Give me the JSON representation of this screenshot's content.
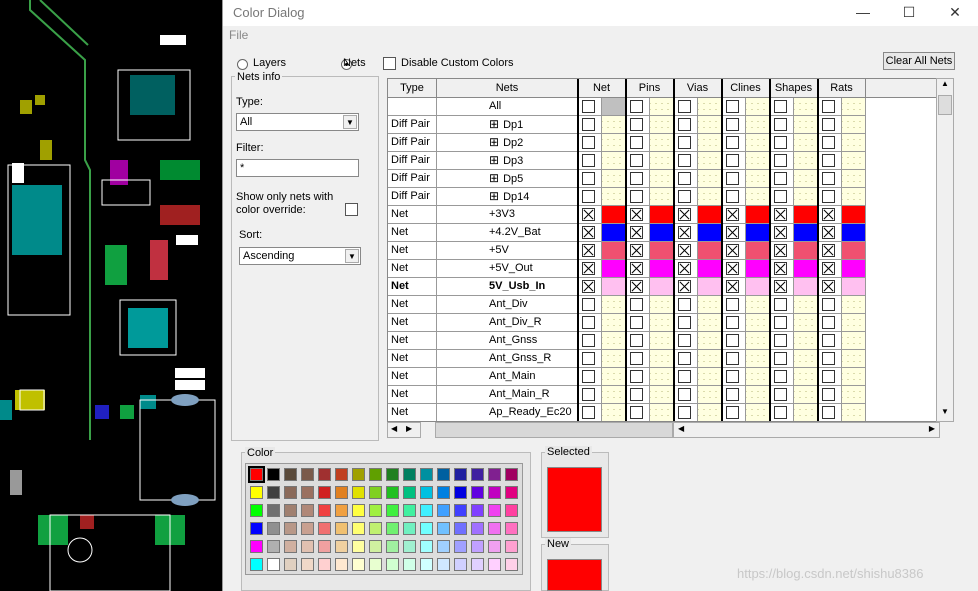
{
  "window": {
    "title": "Color Dialog",
    "minimize": "—",
    "maximize": "☐",
    "close": "✕"
  },
  "menu": {
    "file": "File"
  },
  "mode": {
    "layers": "Layers",
    "nets": "Nets",
    "selected": "nets"
  },
  "disable_custom": {
    "label": "Disable Custom Colors",
    "checked": false
  },
  "clear_all": "Clear All Nets",
  "nets_info": {
    "title": "Nets info",
    "type_label": "Type:",
    "type_value": "All",
    "filter_label": "Filter:",
    "filter_value": "*",
    "show_only_label": "Show only nets with color override:",
    "sort_label": "Sort:",
    "sort_value": "Ascending"
  },
  "grid": {
    "headers": [
      "Type",
      "Nets",
      "Net",
      "Pins",
      "Vias",
      "Clines",
      "Shapes",
      "Rats"
    ],
    "rows": [
      {
        "type": "",
        "name": "All",
        "expand": false,
        "bold": false,
        "checked": false,
        "color": "#c0c0c0"
      },
      {
        "type": "Diff Pair",
        "name": "Dp1",
        "expand": true,
        "bold": false,
        "checked": false,
        "color": ""
      },
      {
        "type": "Diff Pair",
        "name": "Dp2",
        "expand": true,
        "bold": false,
        "checked": false,
        "color": ""
      },
      {
        "type": "Diff Pair",
        "name": "Dp3",
        "expand": true,
        "bold": false,
        "checked": false,
        "color": ""
      },
      {
        "type": "Diff Pair",
        "name": "Dp5",
        "expand": true,
        "bold": false,
        "checked": false,
        "color": ""
      },
      {
        "type": "Diff Pair",
        "name": "Dp14",
        "expand": true,
        "bold": false,
        "checked": false,
        "color": ""
      },
      {
        "type": "Net",
        "name": "+3V3",
        "expand": false,
        "bold": false,
        "checked": true,
        "color": "#ff0000"
      },
      {
        "type": "Net",
        "name": "+4.2V_Bat",
        "expand": false,
        "bold": false,
        "checked": true,
        "color": "#0000ff"
      },
      {
        "type": "Net",
        "name": "+5V",
        "expand": false,
        "bold": false,
        "checked": true,
        "color": "#f05070"
      },
      {
        "type": "Net",
        "name": "+5V_Out",
        "expand": false,
        "bold": false,
        "checked": true,
        "color": "#ff00ff"
      },
      {
        "type": "Net",
        "name": "5V_Usb_In",
        "expand": false,
        "bold": true,
        "checked": true,
        "color": "#ffc0f0"
      },
      {
        "type": "Net",
        "name": "Ant_Div",
        "expand": false,
        "bold": false,
        "checked": false,
        "color": ""
      },
      {
        "type": "Net",
        "name": "Ant_Div_R",
        "expand": false,
        "bold": false,
        "checked": false,
        "color": ""
      },
      {
        "type": "Net",
        "name": "Ant_Gnss",
        "expand": false,
        "bold": false,
        "checked": false,
        "color": ""
      },
      {
        "type": "Net",
        "name": "Ant_Gnss_R",
        "expand": false,
        "bold": false,
        "checked": false,
        "color": ""
      },
      {
        "type": "Net",
        "name": "Ant_Main",
        "expand": false,
        "bold": false,
        "checked": false,
        "color": ""
      },
      {
        "type": "Net",
        "name": "Ant_Main_R",
        "expand": false,
        "bold": false,
        "checked": false,
        "color": ""
      },
      {
        "type": "Net",
        "name": "Ap_Ready_Ec20",
        "expand": false,
        "bold": false,
        "checked": false,
        "color": ""
      }
    ]
  },
  "color_panel": {
    "title": "Color",
    "selected_label": "Selected",
    "new_label": "New",
    "selected_color": "#ff0000",
    "new_color": "#ff0000"
  },
  "palette": [
    [
      "#ff0000",
      "#000000",
      "#5a4a3a",
      "#7a5a4a",
      "#a03030",
      "#c04020",
      "#a0a000",
      "#60a000",
      "#208020",
      "#008060",
      "#0090a0",
      "#0060a0",
      "#2020a0",
      "#4020a0",
      "#802090",
      "#a00060"
    ],
    [
      "#ffff00",
      "#404040",
      "#8a6a5a",
      "#9a7060",
      "#d02020",
      "#e08020",
      "#e0e000",
      "#80d020",
      "#20c020",
      "#00c080",
      "#00c0e0",
      "#0080e0",
      "#0000e0",
      "#6000e0",
      "#c000c0",
      "#e00080"
    ],
    [
      "#00ff00",
      "#707070",
      "#a08070",
      "#b08878",
      "#f04040",
      "#f0a040",
      "#ffff40",
      "#a0f040",
      "#40f040",
      "#40f0a0",
      "#40f0ff",
      "#40a0ff",
      "#4040ff",
      "#8040ff",
      "#f040f0",
      "#ff40a0"
    ],
    [
      "#0000ff",
      "#909090",
      "#b89888",
      "#c8a090",
      "#f07070",
      "#f0c070",
      "#ffff70",
      "#c0f070",
      "#70f070",
      "#70f0c0",
      "#70ffff",
      "#70c0ff",
      "#7070ff",
      "#a070ff",
      "#f070f0",
      "#ff70c0"
    ],
    [
      "#ff00ff",
      "#b0b0b0",
      "#d0b0a0",
      "#e0c0b0",
      "#f0a0a0",
      "#f0d0a0",
      "#ffffa0",
      "#d0f0a0",
      "#a0f0a0",
      "#a0f0d0",
      "#a0ffff",
      "#a0d0ff",
      "#a0a0ff",
      "#c0a0ff",
      "#f0a0f0",
      "#ffa0d0"
    ],
    [
      "#00ffff",
      "#ffffff",
      "#e0d0c0",
      "#f0d8c8",
      "#ffd0d0",
      "#ffe8d0",
      "#ffffd0",
      "#e8ffd0",
      "#d0ffd0",
      "#d0ffe8",
      "#d0ffff",
      "#d0e8ff",
      "#d0d0ff",
      "#e0d0ff",
      "#ffd0ff",
      "#ffd0e8"
    ]
  ],
  "watermark": "https://blog.csdn.net/shishu8386"
}
